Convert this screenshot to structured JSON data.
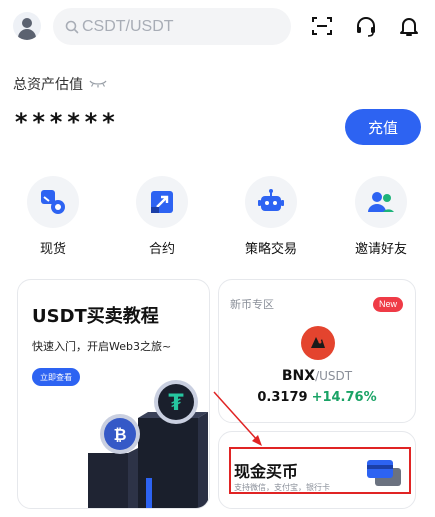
{
  "header": {
    "search_placeholder": "CSDT/USDT",
    "icons": [
      "avatar",
      "search-icon",
      "scan-icon",
      "headset-icon",
      "bell-icon"
    ]
  },
  "assets": {
    "label": "总资产估值",
    "value": "******",
    "deposit_label": "充值"
  },
  "quick_nav": [
    {
      "label": "现货",
      "icon": "spot-icon"
    },
    {
      "label": "合约",
      "icon": "futures-icon"
    },
    {
      "label": "策略交易",
      "icon": "bot-icon"
    },
    {
      "label": "邀请好友",
      "icon": "invite-icon"
    }
  ],
  "tutorial_card": {
    "title": "USDT买卖教程",
    "subtitle": "快速入门，开启Web3之旅~",
    "cta": "立即查看"
  },
  "new_coin_card": {
    "zone_label": "新币专区",
    "badge": "New",
    "base": "BNX",
    "quote": "/USDT",
    "price": "0.3179",
    "change": "+14.76%"
  },
  "buy_coin_card": {
    "title": "现金买币",
    "subtitle": "支持微信，支付宝，银行卡"
  },
  "colors": {
    "accent": "#2d63f2",
    "positive": "#1aa366",
    "badge": "#ef3b46",
    "highlight": "#e02424"
  }
}
